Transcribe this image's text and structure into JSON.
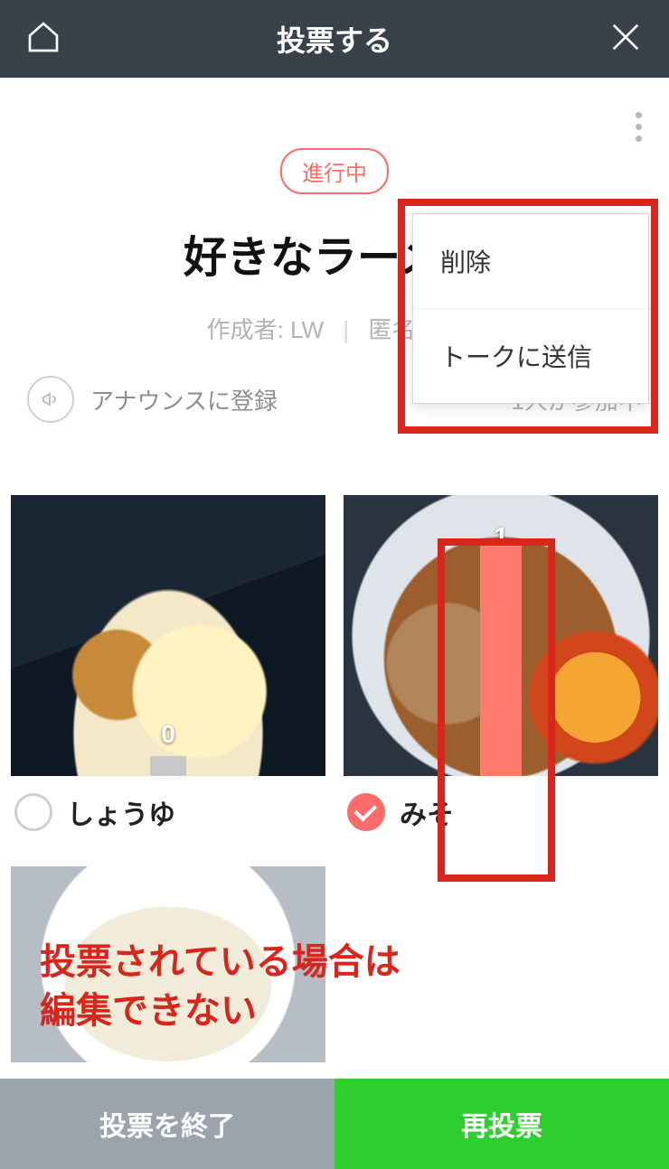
{
  "header": {
    "title": "投票する"
  },
  "poll": {
    "status_label": "進行中",
    "title": "好きなラーメン",
    "author_label": "作成者",
    "author_name": "LW",
    "option_label": "匿名投票"
  },
  "subbar": {
    "announce_label": "アナウンスに登録",
    "participants_text": "1人が参加中"
  },
  "options": [
    {
      "label": "しょうゆ",
      "votes": "0",
      "selected": false
    },
    {
      "label": "みそ",
      "votes": "1",
      "selected": true
    }
  ],
  "footer": {
    "end_label": "投票を終了",
    "revote_label": "再投票"
  },
  "popup": {
    "items": [
      "削除",
      "トークに送信"
    ]
  },
  "annotation": {
    "line1": "投票されている場合は",
    "line2": "編集できない"
  }
}
